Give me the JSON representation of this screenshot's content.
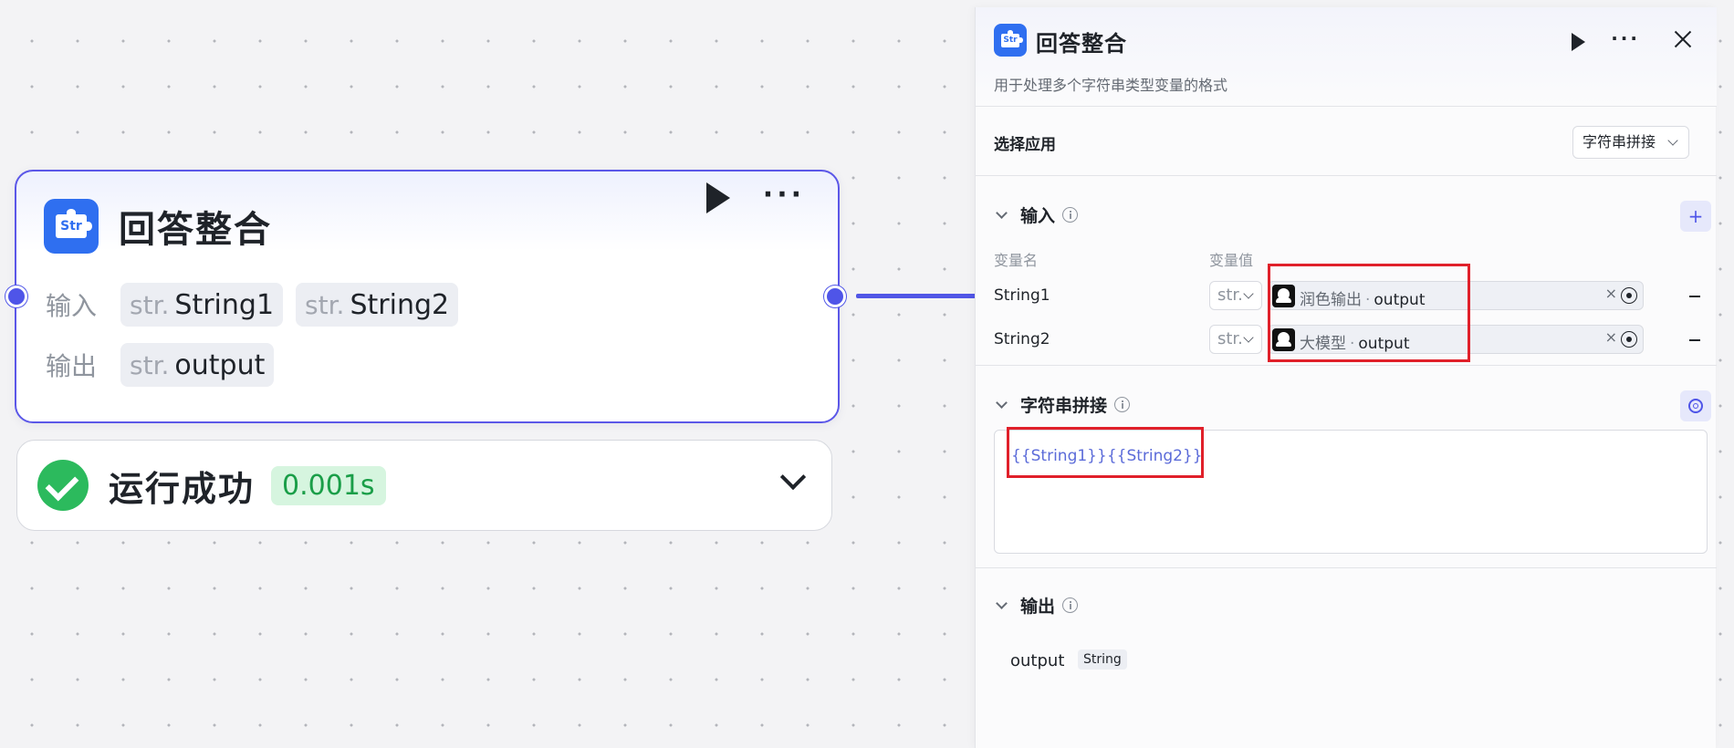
{
  "node": {
    "title": "回答整合",
    "icon_text": "Str",
    "input_label": "输入",
    "output_label": "输出",
    "type_prefix": "str.",
    "inputs": [
      "String1",
      "String2"
    ],
    "outputs": [
      "output"
    ]
  },
  "result": {
    "status": "运行成功",
    "duration": "0.001s"
  },
  "panel": {
    "title": "回答整合",
    "icon_text": "Str",
    "description": "用于处理多个字符串类型变量的格式",
    "select_app_label": "选择应用",
    "select_app_value": "字符串拼接",
    "input_section": "输入",
    "col_name": "变量名",
    "col_value": "变量值",
    "variables": [
      {
        "name": "String1",
        "type": "str.",
        "source": "润色输出",
        "field": "output",
        "sep": "·",
        "clear": "×"
      },
      {
        "name": "String2",
        "type": "str.",
        "source": "大模型",
        "field": "output",
        "sep": "·",
        "clear": "×"
      }
    ],
    "add_symbol": "+",
    "concat_section": "字符串拼接",
    "template": "{{String1}}{{String2}}",
    "output_section": "输出",
    "output_name": "output",
    "output_type": "String"
  },
  "colors": {
    "accent": "#4f55e8",
    "app_icon": "#2f6ff0",
    "success": "#2cba5d",
    "highlight": "#e0202a"
  }
}
